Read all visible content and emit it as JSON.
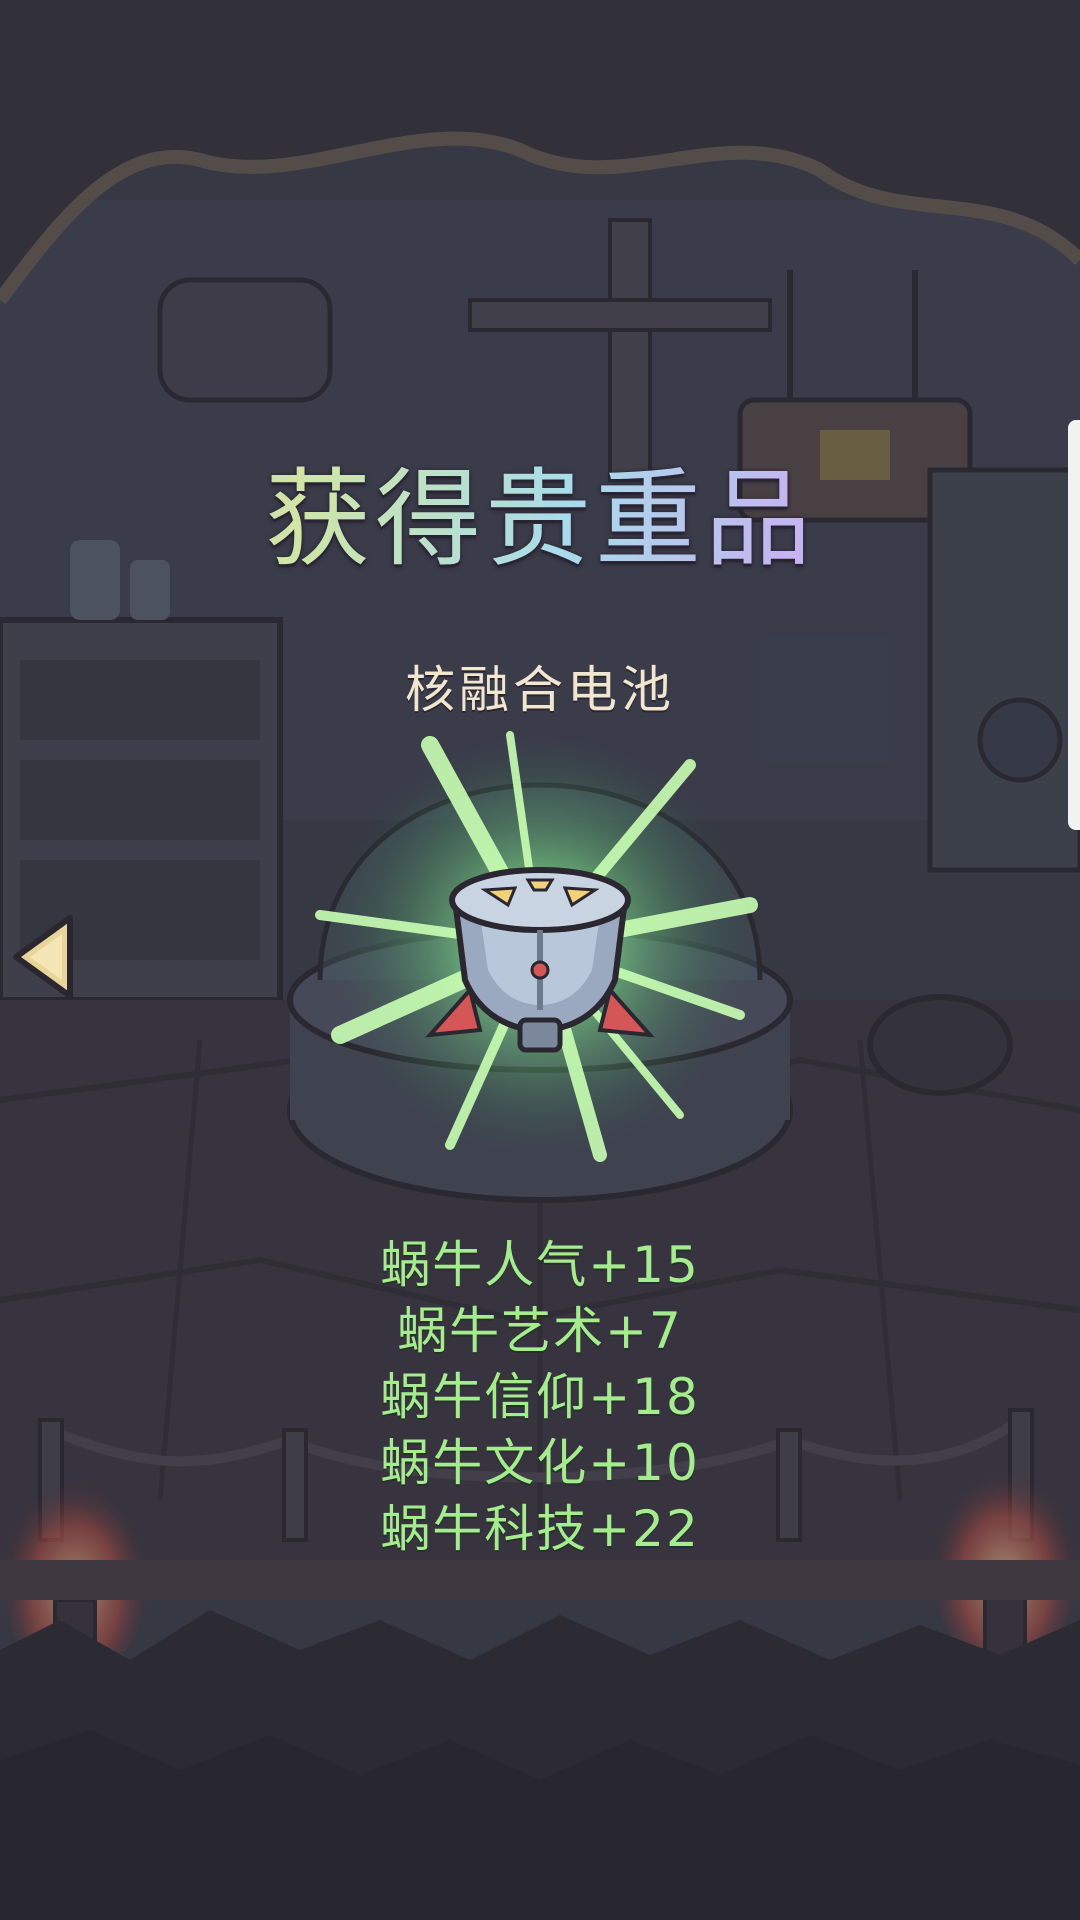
{
  "popup": {
    "title": "获得贵重品",
    "item_name": "核融合电池",
    "item_icon": "fusion-battery-icon",
    "stats": [
      "蜗牛人气+15",
      "蜗牛艺术+7",
      "蜗牛信仰+18",
      "蜗牛文化+10",
      "蜗牛科技+22"
    ]
  },
  "nav": {
    "back_icon": "left-arrow-icon"
  },
  "colors": {
    "stat_text": "#a5ec8f",
    "item_name_text": "#f1e6cf",
    "glow": "#7fe38a",
    "overlay": "#3a3a46"
  }
}
